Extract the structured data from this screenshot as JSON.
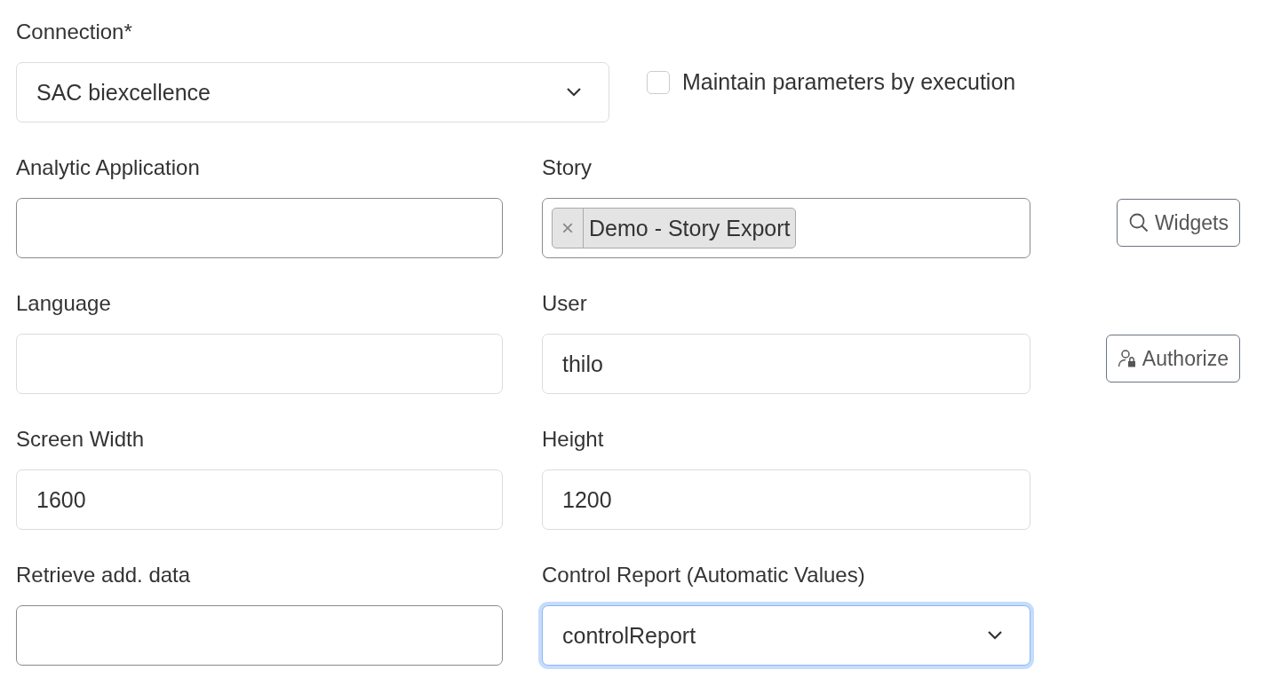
{
  "connection": {
    "label": "Connection*",
    "value": "SAC biexcellence"
  },
  "maintain_checkbox": {
    "label": "Maintain parameters by execution",
    "checked": false
  },
  "rows": [
    {
      "fields": [
        {
          "label": "Analytic Application",
          "kind": "text",
          "emphasized": true,
          "focused": false
        },
        {
          "label": "Story",
          "kind": "tags",
          "tags": [
            {
              "remove": "×",
              "label": "Demo - Story Export"
            }
          ],
          "emphasized": true,
          "focused": false
        }
      ],
      "button": {
        "label": "Widgets"
      }
    },
    {
      "fields": [
        {
          "label": "Language",
          "kind": "text",
          "emphasized": false,
          "focused": false
        },
        {
          "label": "User",
          "kind": "text",
          "value": "thilo",
          "emphasized": false,
          "focused": false
        }
      ],
      "button": {
        "label": "Authorize"
      }
    },
    {
      "fields": [
        {
          "label": "Screen Width",
          "kind": "text",
          "value": "1600",
          "emphasized": false,
          "focused": false
        },
        {
          "label": "Height",
          "kind": "text",
          "value": "1200",
          "emphasized": false,
          "focused": false
        }
      ]
    },
    {
      "fields": [
        {
          "label": "Retrieve add. data",
          "kind": "text",
          "emphasized": true,
          "focused": false
        },
        {
          "label": "Control Report (Automatic Values)",
          "kind": "select",
          "value": "controlReport",
          "emphasized": false,
          "focused": true
        }
      ]
    }
  ]
}
